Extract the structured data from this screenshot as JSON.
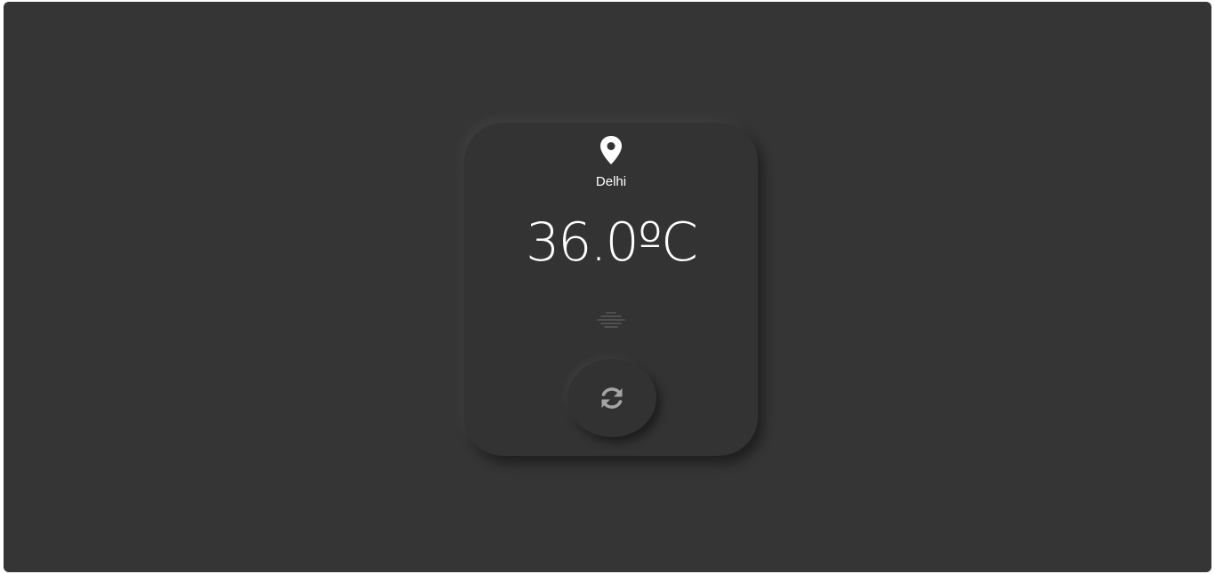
{
  "weather": {
    "city": "Delhi",
    "temperature": "36.0ºC",
    "condition_icon": "haze-icon",
    "location_icon": "map-pin-icon",
    "refresh_icon": "refresh-icon"
  },
  "colors": {
    "background": "#353535",
    "card": "#333333",
    "text": "#ffffff",
    "icon_muted": "#9a9a9a"
  }
}
